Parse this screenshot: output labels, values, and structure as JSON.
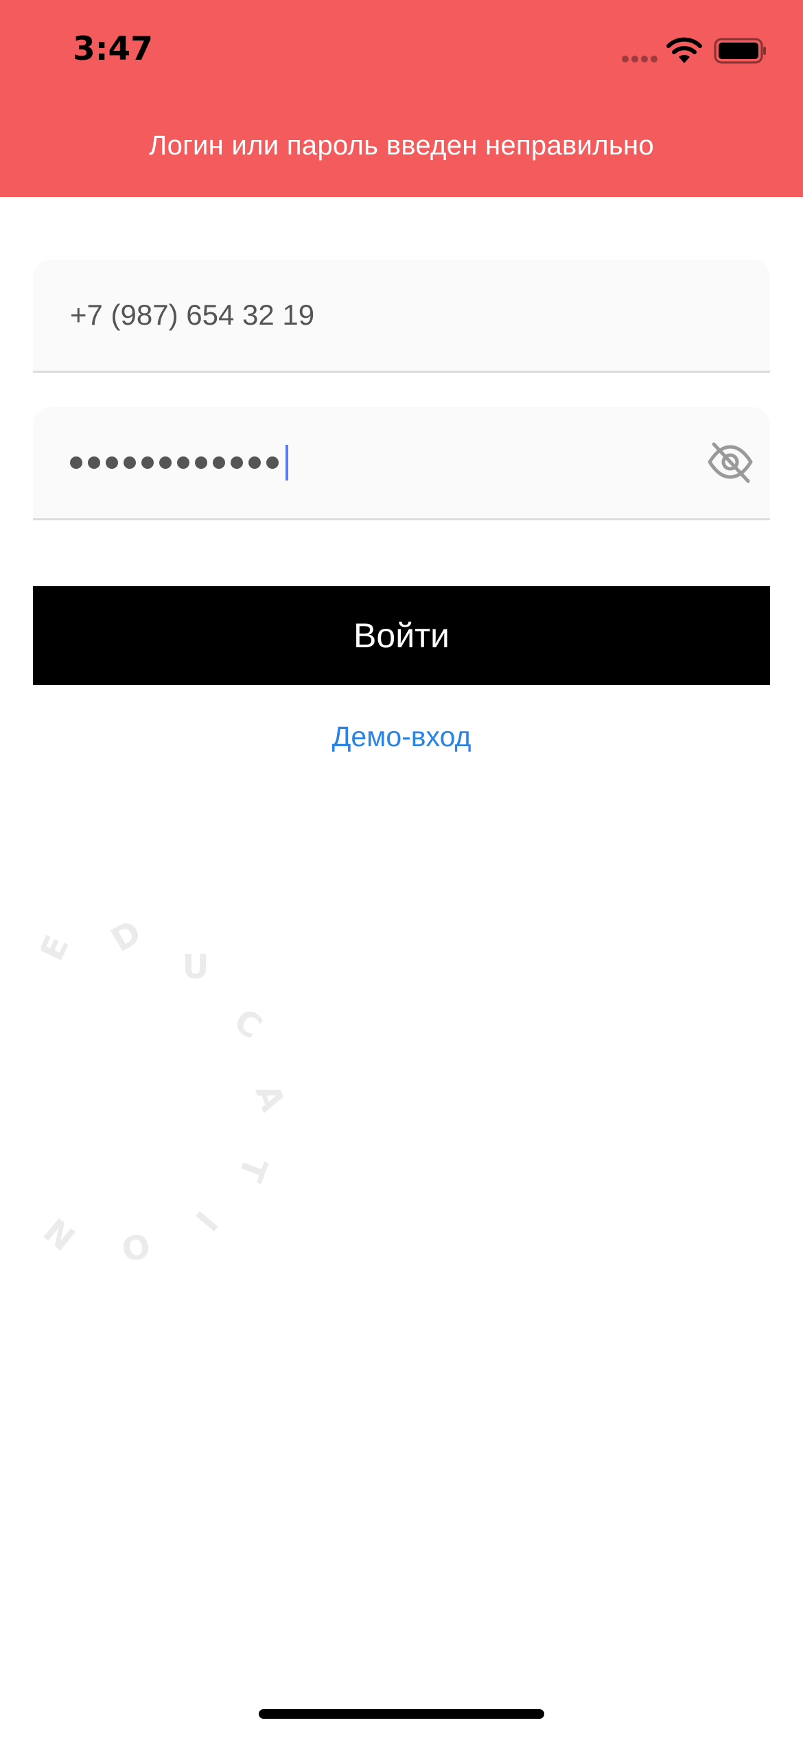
{
  "status_bar": {
    "time": "3:47",
    "icons": [
      "cellular-signal-icon",
      "wifi-icon",
      "battery-icon"
    ]
  },
  "error_banner": {
    "message": "Логин или пароль введен неправильно",
    "color": "#f35b5c"
  },
  "form": {
    "phone": {
      "value": "+7 (987) 654 32 19"
    },
    "password": {
      "masked_length": 12,
      "visibility_icon": "eye-off-icon"
    },
    "submit_label": "Войти",
    "demo_link_label": "Демо-вход"
  },
  "watermark": {
    "letters": [
      "E",
      "D",
      "U",
      "C",
      "A",
      "T",
      "I",
      "O",
      "N"
    ]
  },
  "colors": {
    "accent_link": "#2a84e6",
    "button_bg": "#000000",
    "caret": "#5b7cf0"
  }
}
